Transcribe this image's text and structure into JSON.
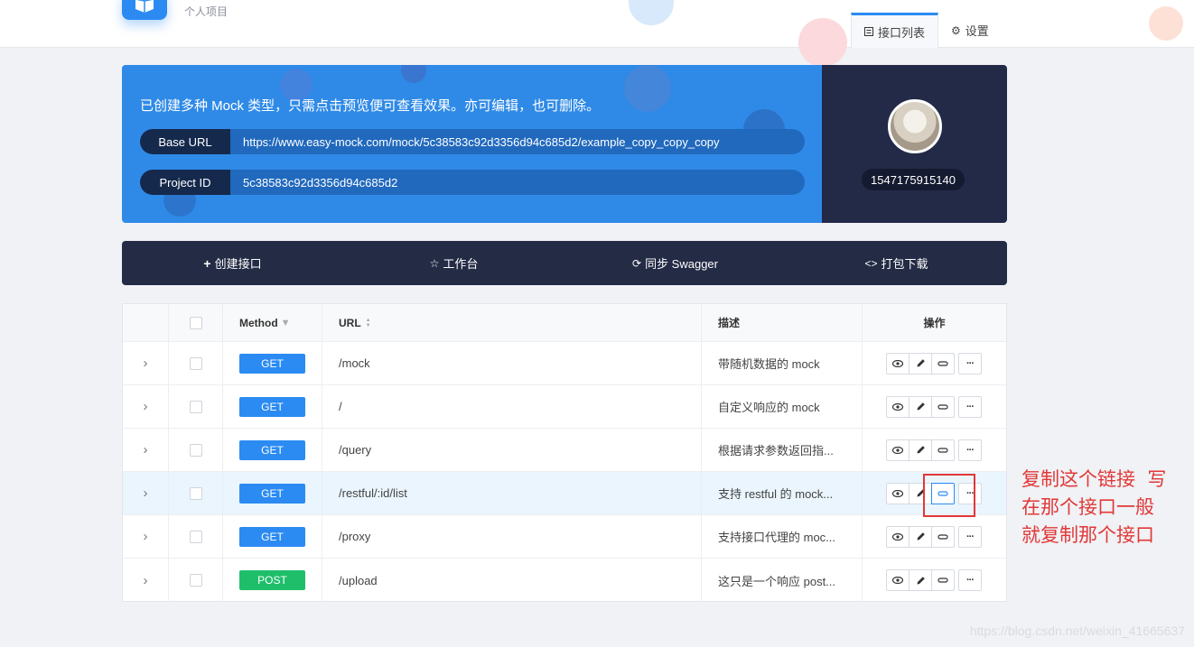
{
  "header": {
    "subtitle": "个人项目",
    "tabs": [
      {
        "label": "接口列表",
        "icon": "list-icon",
        "active": true
      },
      {
        "label": "设置",
        "icon": "gear-icon",
        "active": false
      }
    ]
  },
  "hero": {
    "description": "已创建多种 Mock 类型，只需点击预览便可查看效果。亦可编辑，也可删除。",
    "base_url_label": "Base URL",
    "base_url": "https://www.easy-mock.com/mock/5c38583c92d3356d94c685d2/example_copy_copy_copy",
    "project_id_label": "Project ID",
    "project_id": "5c38583c92d3356d94c685d2"
  },
  "profile": {
    "user_id": "1547175915140"
  },
  "toolbar": {
    "create": "创建接口",
    "workbench": "工作台",
    "sync": "同步 Swagger",
    "download": "打包下载"
  },
  "table": {
    "headers": {
      "method": "Method",
      "url": "URL",
      "desc": "描述",
      "ops": "操作"
    },
    "rows": [
      {
        "method": "GET",
        "url": "/mock",
        "desc": "带随机数据的 mock"
      },
      {
        "method": "GET",
        "url": "/",
        "desc": "自定义响应的 mock"
      },
      {
        "method": "GET",
        "url": "/query",
        "desc": "根据请求参数返回指..."
      },
      {
        "method": "GET",
        "url": "/restful/:id/list",
        "desc": "支持 restful 的 mock..."
      },
      {
        "method": "GET",
        "url": "/proxy",
        "desc": "支持接口代理的 moc..."
      },
      {
        "method": "POST",
        "url": "/upload",
        "desc": "这只是一个响应 post..."
      }
    ]
  },
  "colors": {
    "accent": "#2b8bf2",
    "get": "#2b8bf2",
    "post": "#1fbe6a",
    "hero": "#2f8ae7",
    "dark": "#232b45",
    "annotation": "#e23838"
  },
  "annotation": {
    "text": "复制这个链接  写\n在那个接口一般\n就复制那个接口"
  },
  "watermark": "https://blog.csdn.net/weixin_41665637"
}
